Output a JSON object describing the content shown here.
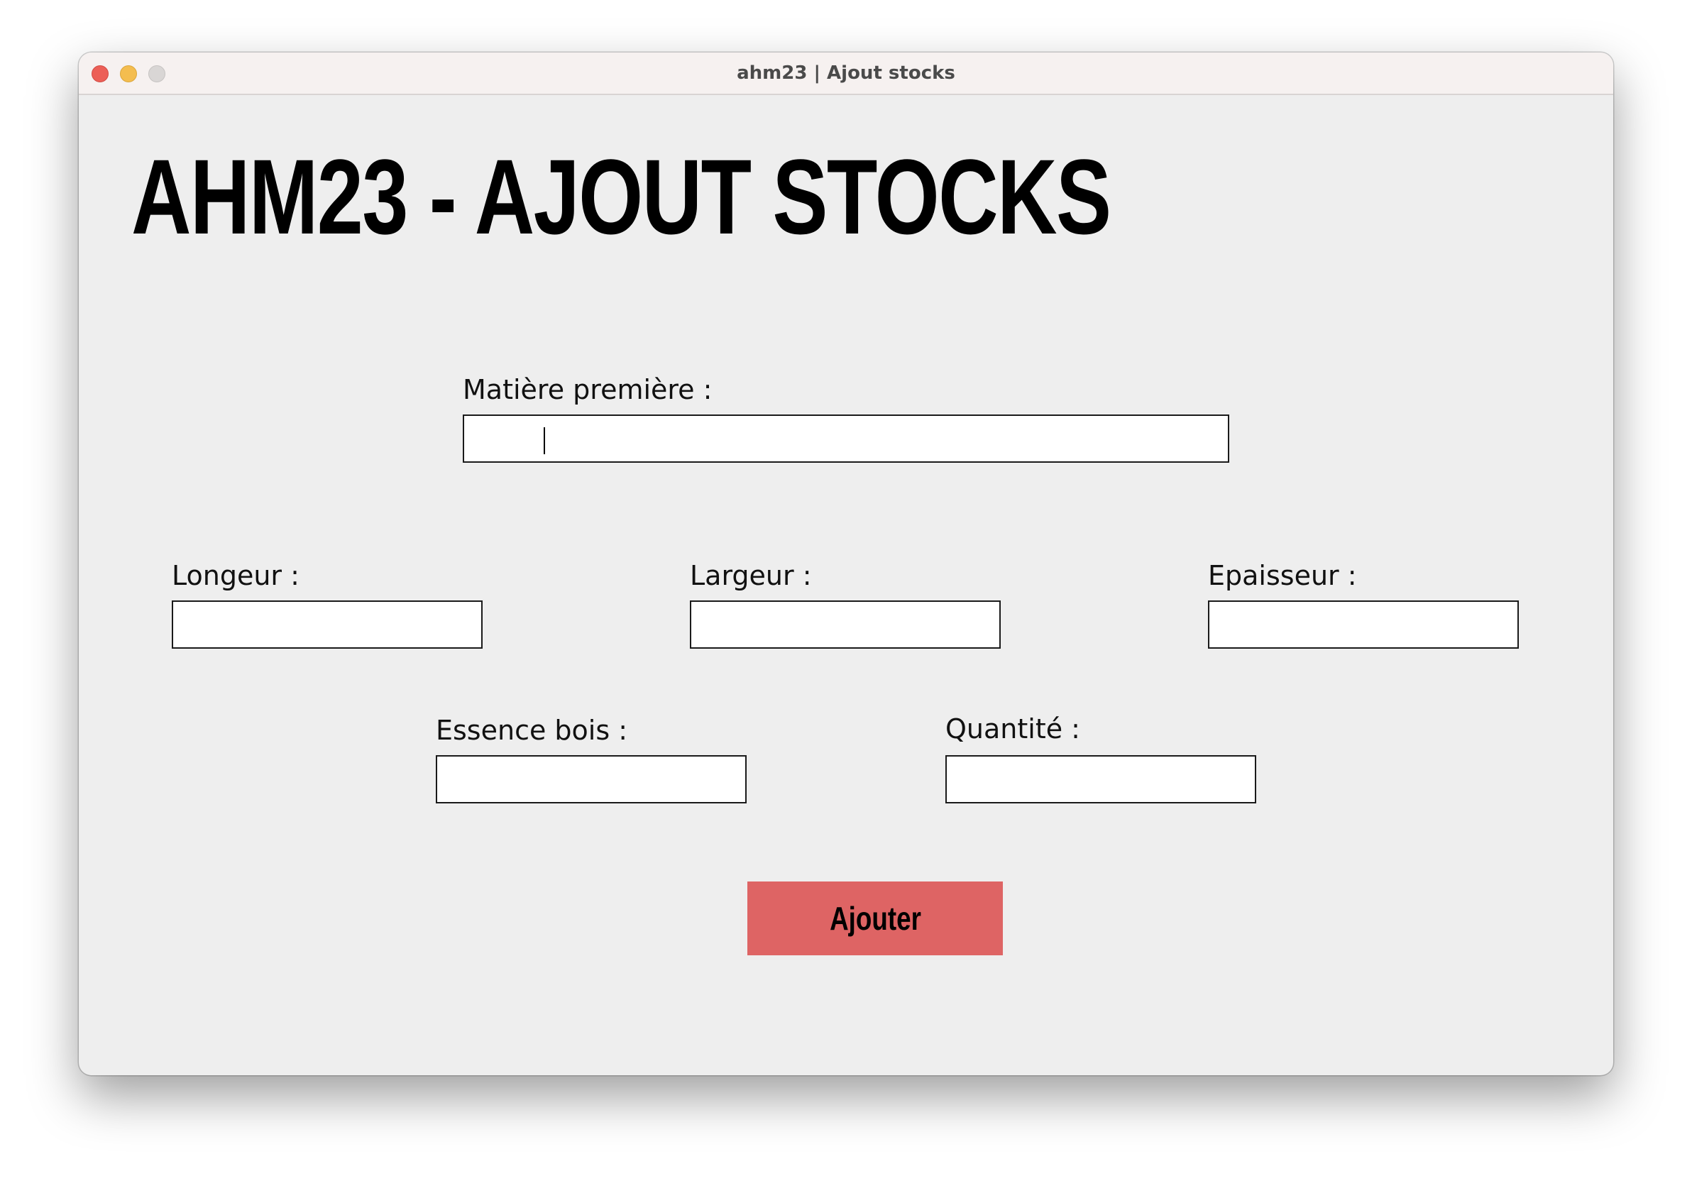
{
  "window": {
    "title": "ahm23 | Ajout stocks"
  },
  "page": {
    "heading": "AHM23 - AJOUT STOCKS"
  },
  "form": {
    "matiere": {
      "label": "Matière première :",
      "value": ""
    },
    "longueur": {
      "label": "Longeur :",
      "value": ""
    },
    "largeur": {
      "label": "Largeur :",
      "value": ""
    },
    "epaisseur": {
      "label": "Epaisseur :",
      "value": ""
    },
    "essence": {
      "label": "Essence bois :",
      "value": ""
    },
    "quantite": {
      "label": "Quantité :",
      "value": ""
    },
    "submit_label": "Ajouter"
  },
  "colors": {
    "button_bg": "#de6464",
    "window_bg": "#eeeeee"
  }
}
